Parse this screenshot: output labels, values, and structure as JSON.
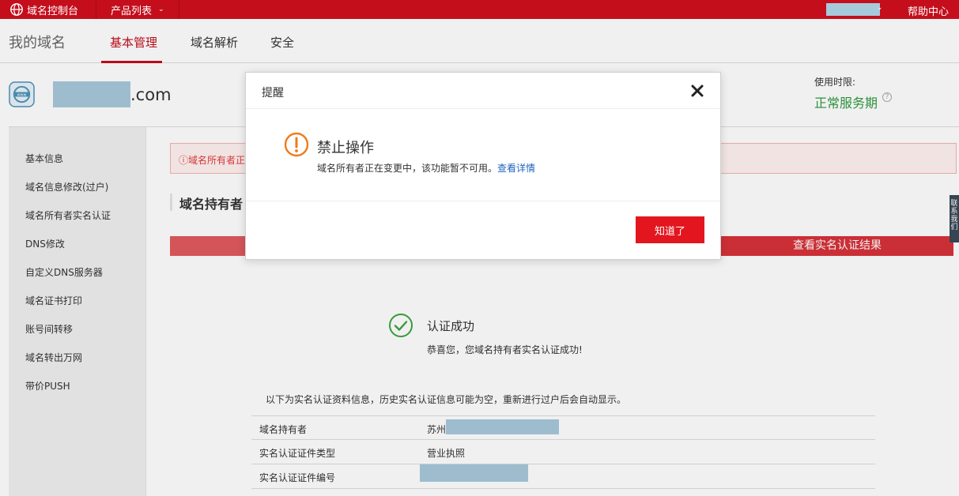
{
  "topbar": {
    "brand": "域名控制台",
    "products": "产品列表",
    "help": "帮助中心"
  },
  "subnav": {
    "title": "我的域名",
    "tabs": [
      "基本管理",
      "域名解析",
      "安全"
    ]
  },
  "domain": {
    "suffix": ".com",
    "validity_label": "使用时限:",
    "validity_value": "正常服务期"
  },
  "sidebar": {
    "items": [
      "基本信息",
      "域名信息修改(过户)",
      "域名所有者实名认证",
      "DNS修改",
      "自定义DNS服务器",
      "域名证书打印",
      "账号间转移",
      "域名转出万网",
      "带价PUSH"
    ]
  },
  "content": {
    "alert_text": "域名所有者正",
    "section_title": "域名持有者",
    "result_button": "查看实名认证结果",
    "success_title": "认证成功",
    "success_sub": "恭喜您，您域名持有者实名认证成功!",
    "info_note": "以下为实名认证资料信息，历史实名认证信息可能为空，重新进行过户后会自动显示。",
    "rows": [
      {
        "key": "域名持有者",
        "value": "苏州"
      },
      {
        "key": "实名认证证件类型",
        "value": "营业执照"
      },
      {
        "key": "实名认证证件编号",
        "value": ""
      }
    ]
  },
  "side_tab": "联系我们",
  "dialog": {
    "title": "提醒",
    "warn_title": "禁止操作",
    "warn_msg": "域名所有者正在变更中，该功能暂不可用。",
    "details_link": "查看详情",
    "ok_label": "知道了"
  },
  "colors": {
    "brand_red": "#c40e1c",
    "ok_green": "#2e9b3e",
    "warn_orange": "#ef7b1a",
    "link_blue": "#1f62c2"
  }
}
